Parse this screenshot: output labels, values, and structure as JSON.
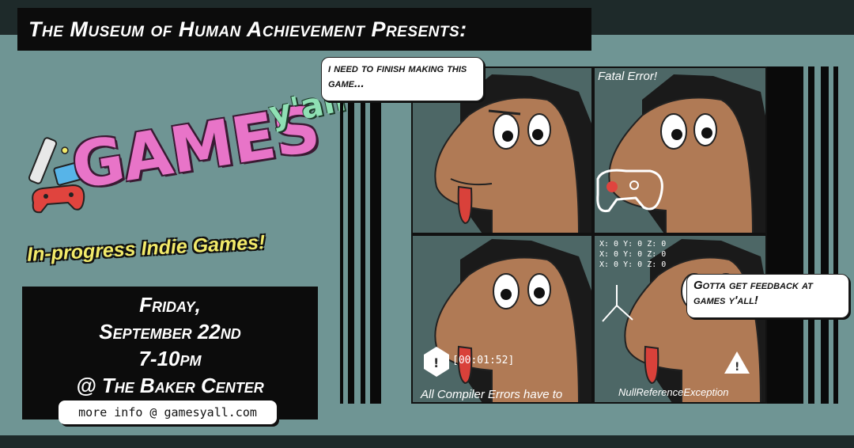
{
  "header": {
    "title": "The Museum of Human Achievement Presents:"
  },
  "logo": {
    "main": "GAMES",
    "sub": "y'all"
  },
  "tagline": "In-progress Indie Games!",
  "event": {
    "day": "Friday,",
    "date": "September 22nd",
    "time": "7-10pm",
    "location": "@ The Baker Center",
    "info": "more info @ gamesyall.com"
  },
  "comic": {
    "bubble_top": "i need to finish making this game...",
    "bubble_bottom": "Gotta get feedback at games y'all!",
    "panel2_caption": "Fatal Error!",
    "panel3_caption": "All Compiler Errors have to",
    "panel3_timer": "[00:01:52]",
    "panel4_caption": "NullReferenceException",
    "panel4_coords": [
      "X: 0 Y: 0 Z: 0",
      "X: 0 Y: 0 Z: 0",
      "X: 0 Y: 0 Z: 0"
    ]
  },
  "colors": {
    "background": "#6f9594",
    "dark": "#0c0c0c",
    "logo_pink": "#e874c8",
    "logo_green": "#8fe0b4",
    "tagline_yellow": "#f2ea6a",
    "horse": "#b07a55"
  }
}
